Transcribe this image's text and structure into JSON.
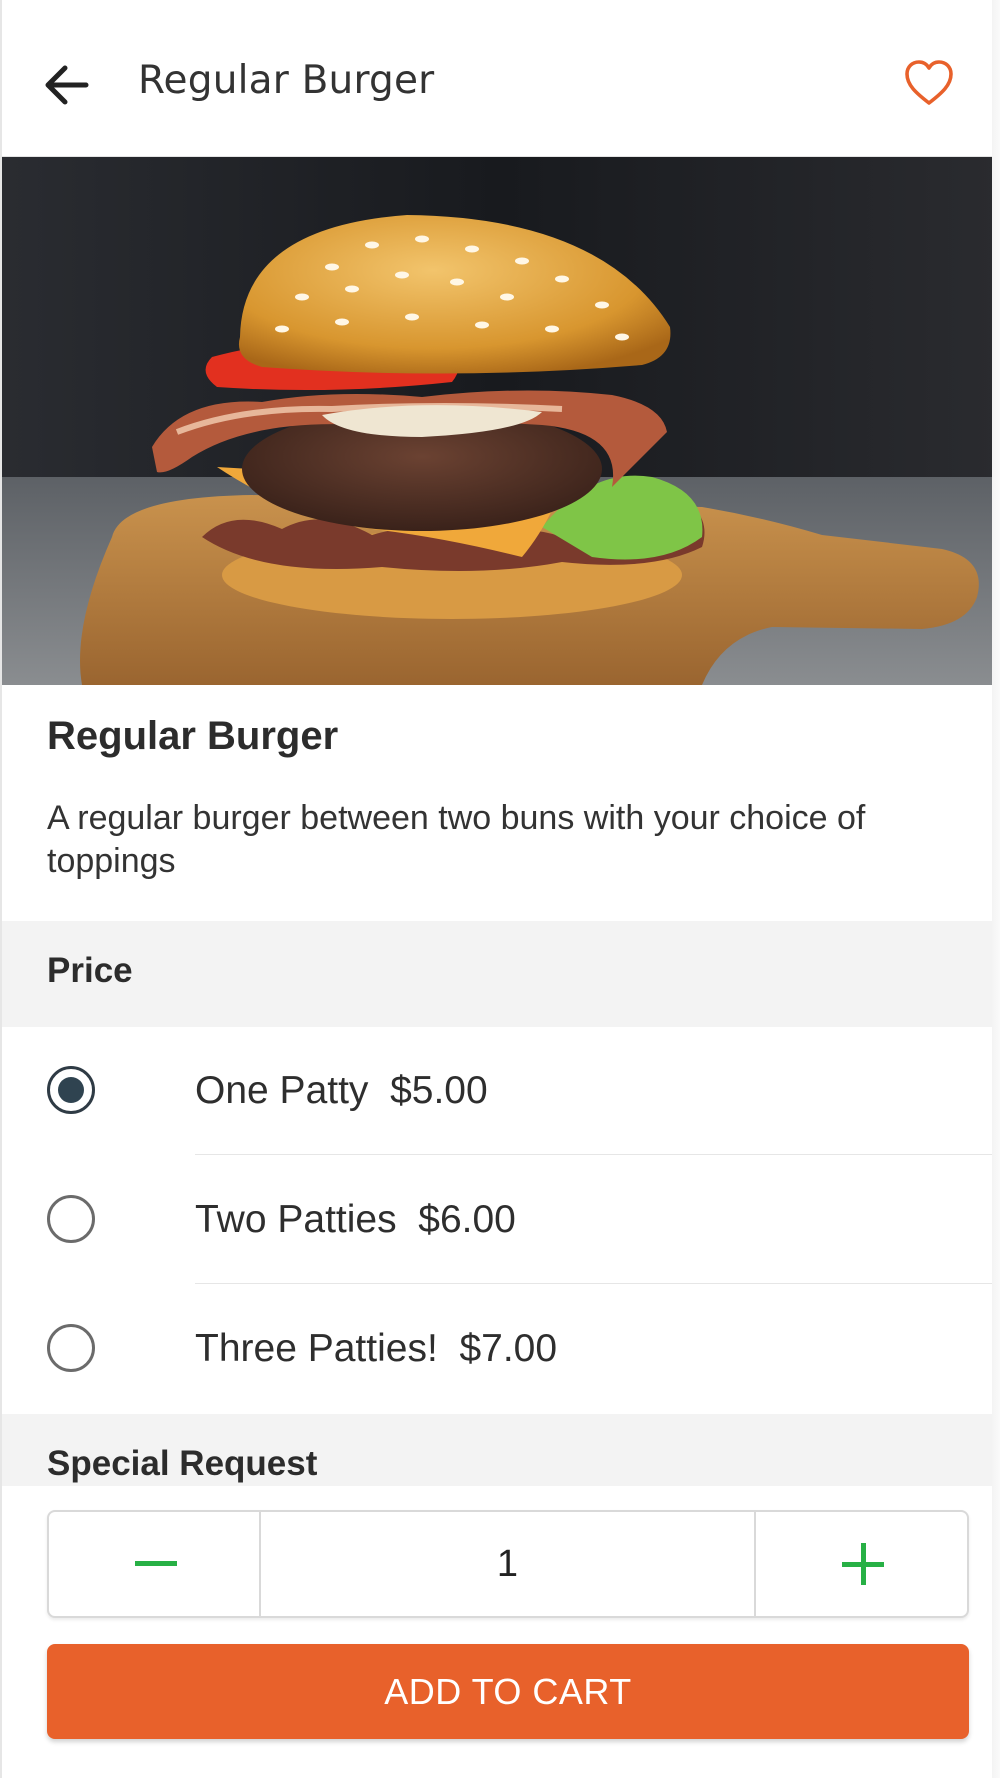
{
  "header": {
    "title": "Regular Burger",
    "back_icon": "arrow-left-icon",
    "favorite_icon": "heart-outline-icon",
    "accent_color": "#e8612b"
  },
  "product": {
    "name": "Regular Burger",
    "description": "A regular burger between two buns with your choice of toppings"
  },
  "price_section": {
    "title": "Price",
    "options": [
      {
        "label": "One Patty  $5.00",
        "selected": true
      },
      {
        "label": "Two Patties  $6.00",
        "selected": false
      },
      {
        "label": "Three Patties!  $7.00",
        "selected": false
      }
    ]
  },
  "special_request": {
    "title": "Special Request"
  },
  "quantity": {
    "value": "1",
    "minus_icon": "minus-icon",
    "plus_icon": "plus-icon",
    "stepper_color": "#27b045"
  },
  "cart": {
    "button_label": "ADD TO CART",
    "button_color": "#e8612b"
  }
}
